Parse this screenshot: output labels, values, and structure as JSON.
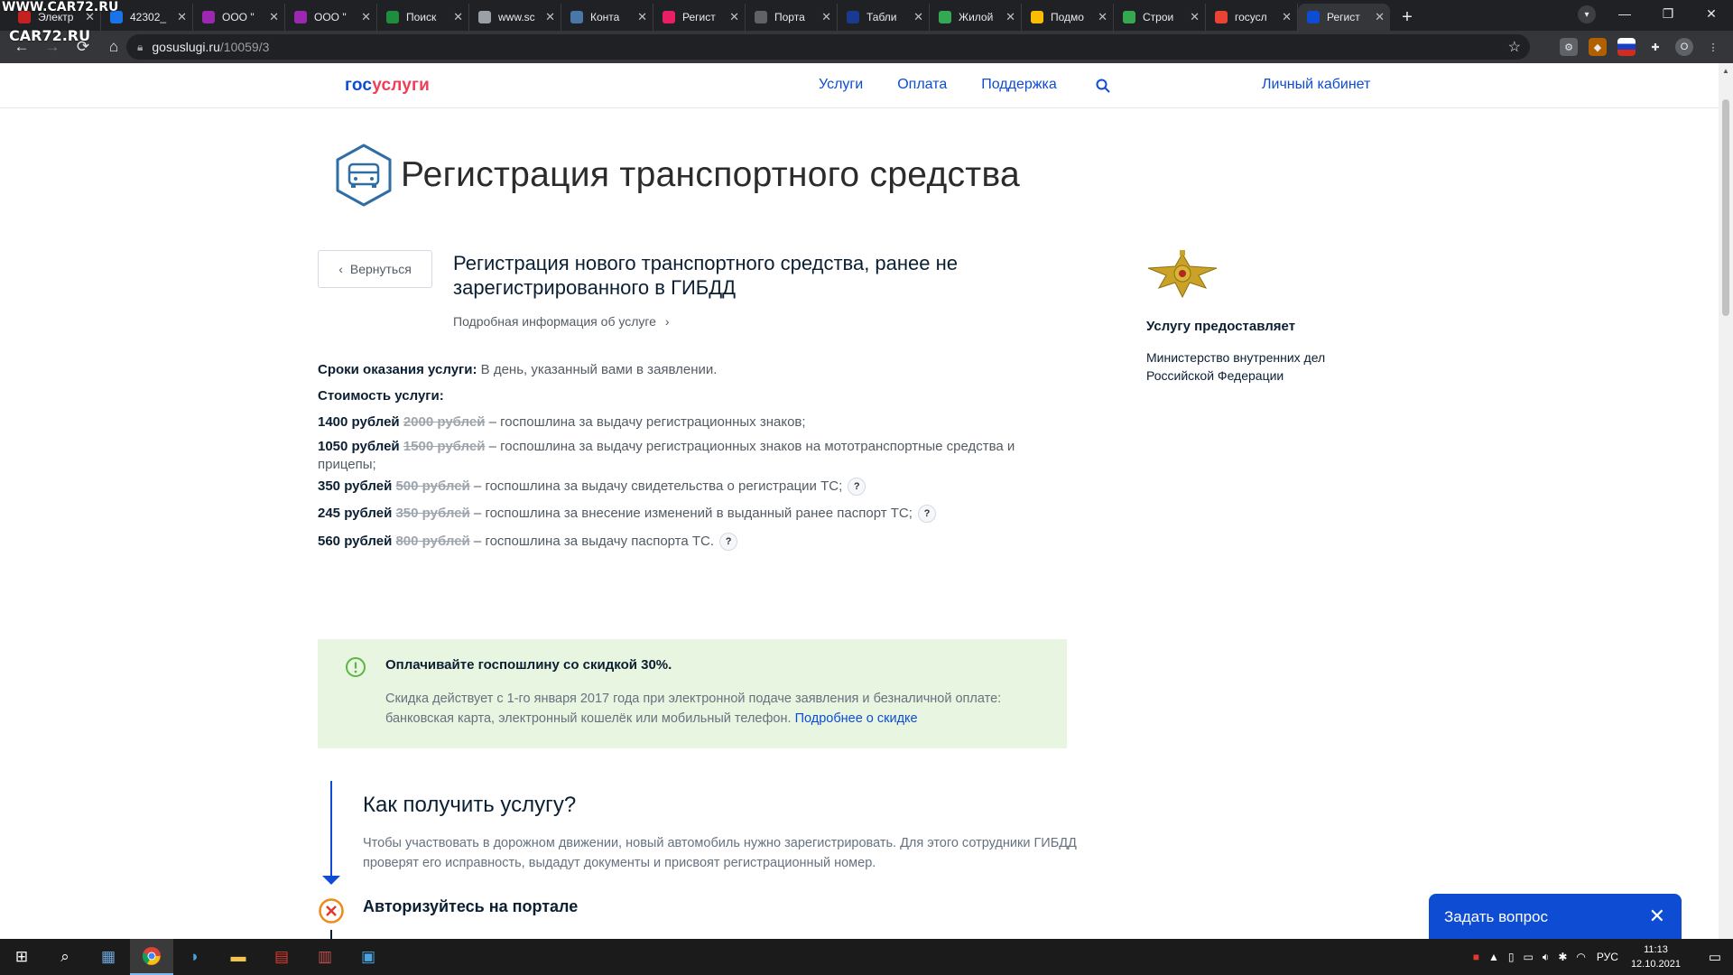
{
  "browser": {
    "tabs": [
      {
        "title": "Электр",
        "color": "#c5221f"
      },
      {
        "title": "42302_",
        "color": "#1a73e8"
      },
      {
        "title": "ООО \"",
        "color": "#9c27b0"
      },
      {
        "title": "ООО \"",
        "color": "#9c27b0"
      },
      {
        "title": "Поиск",
        "color": "#1e8e3e"
      },
      {
        "title": "www.sc",
        "color": "#9aa0a6"
      },
      {
        "title": "Конта",
        "color": "#4a76a8"
      },
      {
        "title": "Регист",
        "color": "#e91e63"
      },
      {
        "title": "Порта",
        "color": "#5f6368"
      },
      {
        "title": "Табли",
        "color": "#1a3a8f"
      },
      {
        "title": "Жилой",
        "color": "#34a853"
      },
      {
        "title": "Подмо",
        "color": "#fbbc04"
      },
      {
        "title": "Строи",
        "color": "#34a853"
      },
      {
        "title": "госусл",
        "color": "#ea4335"
      },
      {
        "title": "Регист",
        "color": "#0d4cd3",
        "active": true
      }
    ],
    "url_host": "gosuslugi.ru",
    "url_path": "/10059/3",
    "profile_initial": "O",
    "watermark_top": "WWW.CAR72.RU",
    "watermark_logo": "CAR72.RU"
  },
  "site": {
    "logo_a": "гос",
    "logo_b": "услуги",
    "nav": [
      "Услуги",
      "Оплата",
      "Поддержка"
    ],
    "cabinet": "Личный кабинет"
  },
  "page": {
    "title": "Регистрация транспортного средства",
    "back": "Вернуться",
    "service_title": "Регистрация нового транспортного средства, ранее не зарегистрированного в ГИБДД",
    "more_info": "Подробная информация об услуге",
    "terms_label": "Сроки оказания услуги:",
    "terms_value": " В день, указанный вами в заявлении.",
    "cost_label": "Стоимость услуги:",
    "fees": [
      {
        "price": "1400 рублей",
        "old": "2000 рублей",
        "desc": " – госпошлина за выдачу регистрационных знаков;",
        "help": false
      },
      {
        "price": "1050 рублей",
        "old": "1500 рублей",
        "desc": " – госпошлина за выдачу регистрационных знаков на мототранспортные средства и прицепы;",
        "help": false
      },
      {
        "price": "350 рублей",
        "old": "500 рублей",
        "desc": " – госпошлина за выдачу свидетельства о регистрации ТС;",
        "help": true
      },
      {
        "price": "245 рублей",
        "old": "350 рублей",
        "desc": " – госпошлина за внесение изменений в выданный ранее паспорт ТС;",
        "help": true
      },
      {
        "price": "560 рублей",
        "old": "800 рублей",
        "desc": " – госпошлина за выдачу паспорта ТС.",
        "help": true
      }
    ],
    "help_glyph": "?"
  },
  "sidebar": {
    "provider_heading": "Услугу предоставляет",
    "provider_name": "Министерство внутренних дел Российской Федерации"
  },
  "discount": {
    "heading": "Оплачивайте госпошлину со скидкой 30%.",
    "text": "Скидка действует с 1-го января 2017 года при электронной подаче заявления и безналичной оплате: банковская карта, электронный кошелёк или мобильный телефон.",
    "link": "Подробнее о скидке"
  },
  "how": {
    "heading": "Как получить услугу?",
    "text": "Чтобы участвовать в дорожном движении, новый автомобиль нужно зарегистрировать. Для этого сотрудники ГИБДД проверят его исправность, выдадут документы и присвоят регистрационный номер.",
    "step1": "Авторизуйтесь на портале"
  },
  "chat": {
    "label": "Задать вопрос"
  },
  "taskbar": {
    "lang": "РУС",
    "time": "11:13",
    "date": "12.10.2021"
  },
  "colors": {
    "brand_blue": "#0d4cd3",
    "brand_red": "#ee3f58",
    "discount_bg": "#e8f5e0",
    "discount_icon": "#5db641",
    "step_error": "#ee8a1b"
  }
}
